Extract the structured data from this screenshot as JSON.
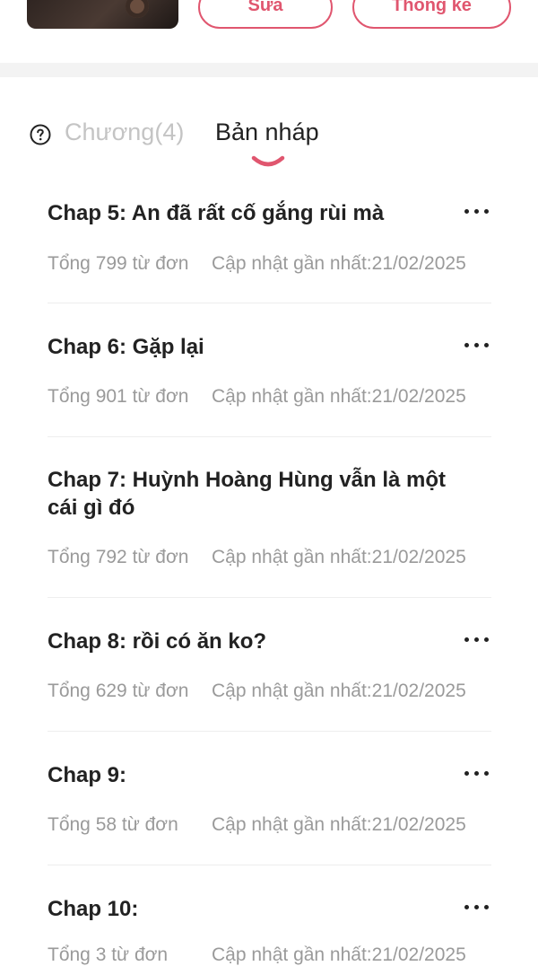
{
  "header": {
    "edit_label": "Sửa",
    "stats_label": "Thống kê"
  },
  "tabs": {
    "chapters_label": "Chương(4)",
    "drafts_label": "Bản nháp",
    "active": "drafts"
  },
  "colors": {
    "accent": "#e0566f",
    "muted": "#9a9a9a",
    "inactive_tab": "#c4c4c4"
  },
  "drafts": [
    {
      "title": "Chap 5: An đã rất cố gắng rùi mà",
      "words": "Tổng 799 từ đơn",
      "updated": "Cập nhật gần nhất:21/02/2025"
    },
    {
      "title": "Chap 6: Gặp lại",
      "words": "Tổng 901 từ đơn",
      "updated": "Cập nhật gần nhất:21/02/2025"
    },
    {
      "title": "Chap 7: Huỳnh Hoàng Hùng vẫn là một cái gì đó",
      "words": "Tổng 792 từ đơn",
      "updated": "Cập nhật gần nhất:21/02/2025"
    },
    {
      "title": "Chap 8: rồi có ăn ko?",
      "words": "Tổng 629 từ đơn",
      "updated": "Cập nhật gần nhất:21/02/2025"
    },
    {
      "title": "Chap 9:",
      "words": "Tổng 58 từ đơn",
      "updated": "Cập nhật gần nhất:21/02/2025"
    },
    {
      "title": "Chap 10:",
      "words": "Tổng 3 từ đơn",
      "updated": "Cập nhật gần nhất:21/02/2025"
    }
  ]
}
